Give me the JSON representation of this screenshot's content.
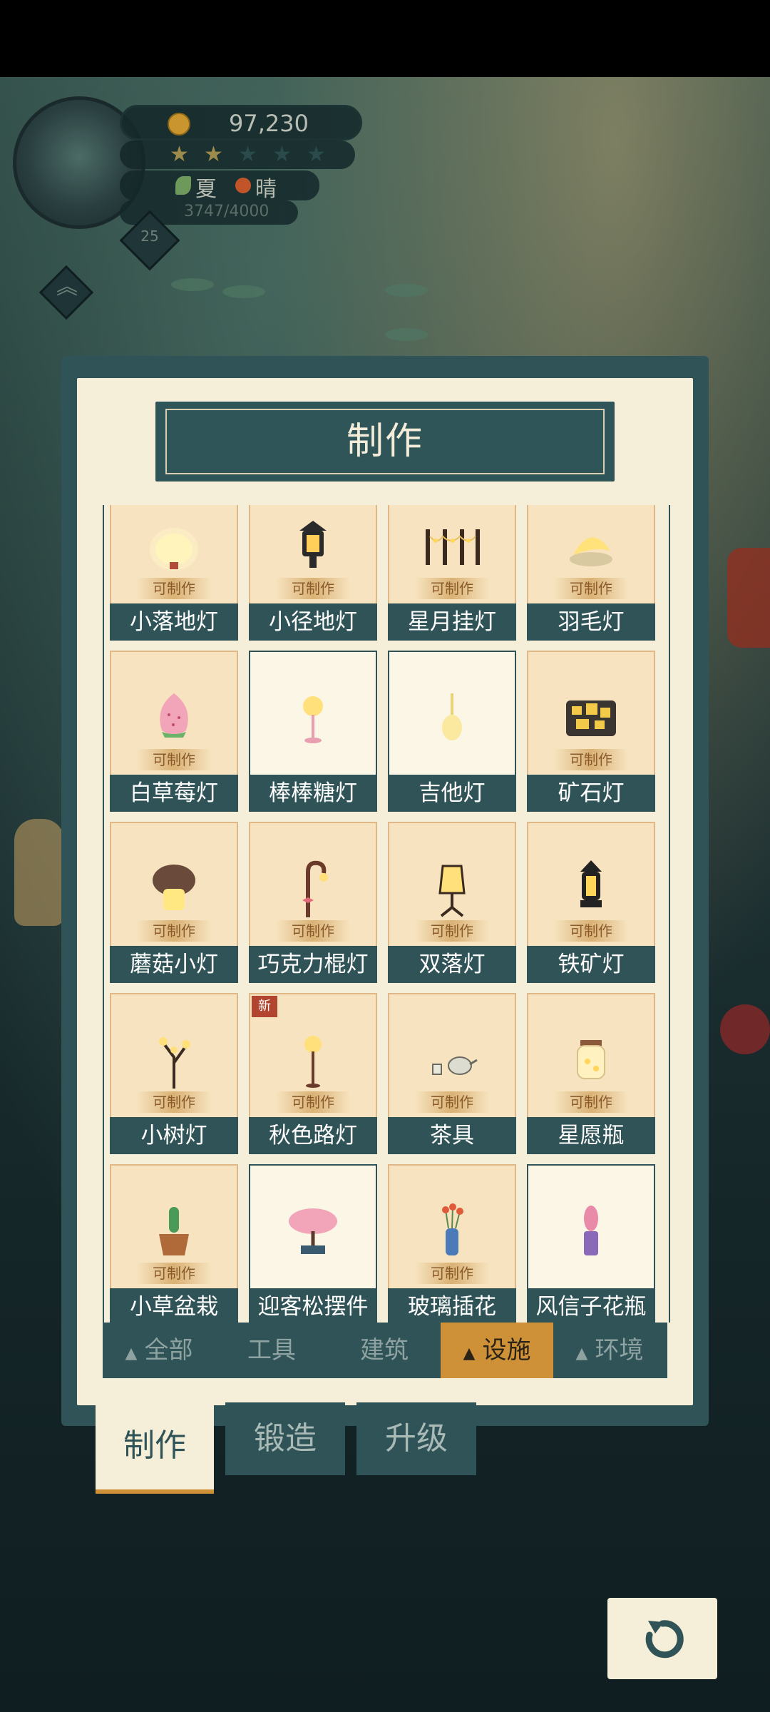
{
  "hud": {
    "coins": "97,230",
    "stars_total": 5,
    "stars_filled": 2,
    "season": "夏",
    "weather": "晴",
    "experience": "3747/4000",
    "level": "25"
  },
  "panel": {
    "title": "制作",
    "craftable_tag": "可制作",
    "new_badge": "新",
    "items": [
      {
        "name": "小落地灯",
        "craftable": true,
        "icon": "small-floor-lamp-icon"
      },
      {
        "name": "小径地灯",
        "craftable": true,
        "icon": "path-lantern-icon"
      },
      {
        "name": "星月挂灯",
        "craftable": true,
        "icon": "star-moon-string-lights-icon"
      },
      {
        "name": "羽毛灯",
        "craftable": true,
        "icon": "feather-lamp-icon"
      },
      {
        "name": "白草莓灯",
        "craftable": true,
        "icon": "white-strawberry-lamp-icon"
      },
      {
        "name": "棒棒糖灯",
        "craftable": false,
        "icon": "lollipop-lamp-icon"
      },
      {
        "name": "吉他灯",
        "craftable": false,
        "icon": "guitar-lamp-icon"
      },
      {
        "name": "矿石灯",
        "craftable": true,
        "icon": "ore-lamp-icon"
      },
      {
        "name": "蘑菇小灯",
        "craftable": true,
        "icon": "mushroom-lamp-icon"
      },
      {
        "name": "巧克力棍灯",
        "craftable": true,
        "icon": "chocolate-stick-lamp-icon"
      },
      {
        "name": "双落灯",
        "craftable": true,
        "icon": "double-floor-lamp-icon"
      },
      {
        "name": "铁矿灯",
        "craftable": true,
        "icon": "iron-lantern-icon"
      },
      {
        "name": "小树灯",
        "craftable": true,
        "icon": "small-tree-lamp-icon"
      },
      {
        "name": "秋色路灯",
        "craftable": true,
        "is_new": true,
        "icon": "autumn-street-lamp-icon"
      },
      {
        "name": "茶具",
        "craftable": true,
        "icon": "tea-set-icon"
      },
      {
        "name": "星愿瓶",
        "craftable": true,
        "icon": "wishing-star-jar-icon"
      },
      {
        "name": "小草盆栽",
        "craftable": true,
        "icon": "cactus-pot-icon"
      },
      {
        "name": "迎客松摆件",
        "craftable": false,
        "icon": "bonsai-pine-icon"
      },
      {
        "name": "玻璃插花",
        "craftable": true,
        "icon": "glass-vase-flower-icon"
      },
      {
        "name": "风信子花瓶",
        "craftable": false,
        "icon": "hyacinth-vase-icon"
      }
    ]
  },
  "categories": [
    {
      "label": "全部",
      "active": false,
      "arrow": true
    },
    {
      "label": "工具",
      "active": false,
      "arrow": false
    },
    {
      "label": "建筑",
      "active": false,
      "arrow": false
    },
    {
      "label": "设施",
      "active": true,
      "arrow": true
    },
    {
      "label": "环境",
      "active": false,
      "arrow": true
    }
  ],
  "bottom_tabs": [
    {
      "label": "制作",
      "active": true
    },
    {
      "label": "锻造",
      "active": false
    },
    {
      "label": "升级",
      "active": false
    }
  ],
  "colors": {
    "panel_teal": "#2f5356",
    "panel_cream": "#f5eed9",
    "accent_orange": "#cf9138",
    "card_peach": "#f7e3bf"
  }
}
